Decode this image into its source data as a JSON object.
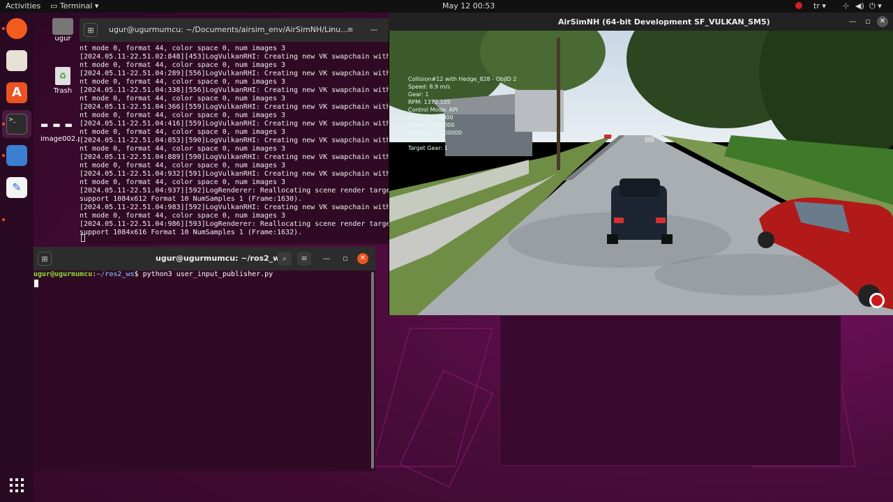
{
  "topbar": {
    "activities": "Activities",
    "app_menu": "Terminal",
    "clock": "May 12  00:53",
    "keyboard_layout": "tr"
  },
  "desktop": {
    "home_label": "ugur",
    "trash_label": "Trash",
    "image_label": "image002.pn"
  },
  "term1": {
    "title": "ugur@ugurmumcu: ~/Documents/airsim_env/AirSimNH/Linu...",
    "lines": [
      "nt mode 0, format 44, color space 0, num images 3",
      "[2024.05.11-22.51.02:848][453]LogVulkanRHI: Creating new VK swapchain with",
      "nt mode 0, format 44, color space 0, num images 3",
      "[2024.05.11-22.51.04:289][556]LogVulkanRHI: Creating new VK swapchain with",
      "nt mode 0, format 44, color space 0, num images 3",
      "[2024.05.11-22.51.04:338][556]LogVulkanRHI: Creating new VK swapchain with",
      "nt mode 0, format 44, color space 0, num images 3",
      "[2024.05.11-22.51.04:366][559]LogVulkanRHI: Creating new VK swapchain with",
      "nt mode 0, format 44, color space 0, num images 3",
      "[2024.05.11-22.51.04:416][559]LogVulkanRHI: Creating new VK swapchain with",
      "nt mode 0, format 44, color space 0, num images 3",
      "[2024.05.11-22.51.04:853][590]LogVulkanRHI: Creating new VK swapchain with",
      "nt mode 0, format 44, color space 0, num images 3",
      "[2024.05.11-22.51.04:889][590]LogVulkanRHI: Creating new VK swapchain with",
      "nt mode 0, format 44, color space 0, num images 3",
      "[2024.05.11-22.51.04:932][591]LogVulkanRHI: Creating new VK swapchain with",
      "nt mode 0, format 44, color space 0, num images 3",
      "[2024.05.11-22.51.04:937][592]LogRenderer: Reallocating scene render targe",
      "support 1084x612 Format 10 NumSamples 1 (Frame:1630).",
      "[2024.05.11-22.51.04:983][592]LogVulkanRHI: Creating new VK swapchain with",
      "nt mode 0, format 44, color space 0, num images 3",
      "[2024.05.11-22.51.04:986][593]LogRenderer: Reallocating scene render targe",
      "support 1084x616 Format 10 NumSamples 1 (Frame:1632)."
    ]
  },
  "term2": {
    "title": "ugur@ugurmumcu: ~/ros2_ws",
    "prompt_user": "ugur@ugurmumcu",
    "prompt_sep": ":",
    "prompt_path": "~/ros2_ws",
    "prompt_end": "$ ",
    "command": "python3 user_input_publisher.py"
  },
  "airsim": {
    "title": "AirSimNH (64-bit Development SF_VULKAN_SM5)",
    "hud": [
      "Collision#12 with Hedge_828 - ObjID 2",
      "Speed: 8.9 m/s",
      "Gear: 1",
      "RPM: 1372.105",
      "Control Mode: API",
      "Accel: 0.000000",
      "Break: 0.000000",
      "Steering: 0.100000",
      "Handbrake: 0",
      "Target Gear: 1"
    ]
  },
  "colors": {
    "ubuntu_orange": "#e95420",
    "prompt_green": "#8ae234",
    "prompt_blue": "#729fcf",
    "close_red": "#e95420"
  }
}
